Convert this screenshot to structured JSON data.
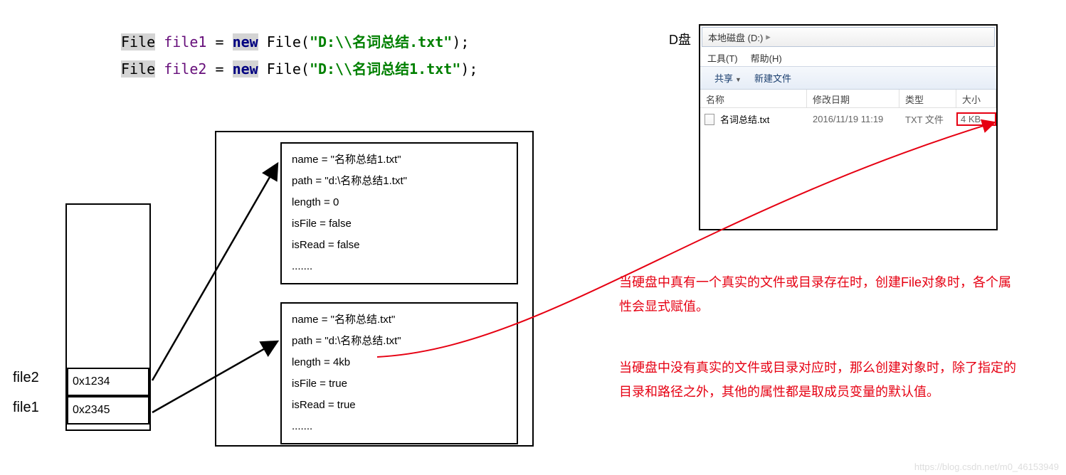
{
  "code": {
    "line1": {
      "type": "File",
      "var": "file1",
      "eq": " = ",
      "kw": "new",
      "ctor": " File(",
      "str": "\"D:\\\\名词总结.txt\"",
      "end": ");"
    },
    "line2": {
      "type": "File",
      "var": "file2",
      "eq": " = ",
      "kw": "new",
      "ctor": " File(",
      "str": "\"D:\\\\名词总结1.txt\"",
      "end": ");"
    }
  },
  "stack": {
    "label_file1": "file1",
    "label_file2": "file2",
    "cell_top": "0x1234",
    "cell_bot": "0x2345"
  },
  "obj1": {
    "name": "name = \"名称总结1.txt\"",
    "path": "path = \"d:\\名称总结1.txt\"",
    "length": "length = 0",
    "isFile": "isFile = false",
    "isRead": "isRead = false",
    "dots": "......."
  },
  "obj2": {
    "name": "name = \"名称总结.txt\"",
    "path": "path = \"d:\\名称总结.txt\"",
    "length": "length = 4kb",
    "isFile": "isFile = true",
    "isRead": "isRead = true",
    "dots": "......."
  },
  "d_label": "D盘",
  "explorer": {
    "path": "本地磁盘 (D:)",
    "menu": {
      "tools": "工具(T)",
      "help": "帮助(H)"
    },
    "toolbar": {
      "share": "共享",
      "new": "新建文件"
    },
    "columns": {
      "name": "名称",
      "date": "修改日期",
      "type": "类型",
      "size": "大小"
    },
    "row": {
      "name": "名词总结.txt",
      "date": "2016/11/19 11:19",
      "type": "TXT 文件",
      "size": "4 KB"
    }
  },
  "note1": "当硬盘中真有一个真实的文件或目录存在时，创建File对象时，各个属性会显式赋值。",
  "note2": "当硬盘中没有真实的文件或目录对应时，那么创建对象时，除了指定的目录和路径之外，其他的属性都是取成员变量的默认值。",
  "watermark": "https://blog.csdn.net/m0_46153949"
}
